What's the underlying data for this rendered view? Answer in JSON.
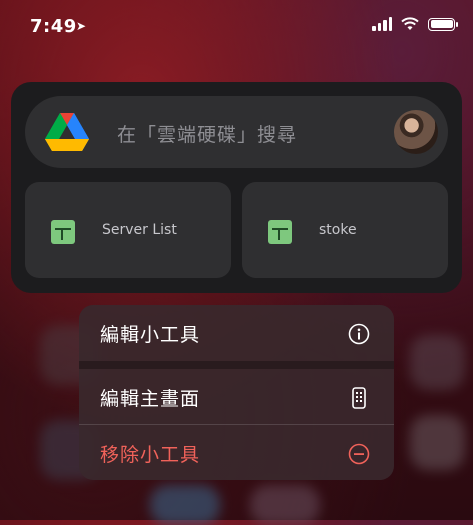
{
  "status_bar": {
    "time": "7:49",
    "location_arrow": "location-arrow-icon",
    "signal": "signal-icon",
    "wifi": "wifi-icon",
    "battery": "battery-icon"
  },
  "widget": {
    "search_placeholder": "在「雲端硬碟」搜尋",
    "files": [
      {
        "name": "Server List",
        "icon": "sheets-icon"
      },
      {
        "name": "stoke",
        "icon": "sheets-icon"
      }
    ]
  },
  "context_menu": {
    "items": [
      {
        "label": "編輯小工具",
        "icon": "info-circle-icon"
      },
      {
        "label": "編輯主畫面",
        "icon": "phone-apps-icon"
      },
      {
        "label": "移除小工具",
        "icon": "minus-circle-icon",
        "color": "#f0625a"
      }
    ]
  }
}
